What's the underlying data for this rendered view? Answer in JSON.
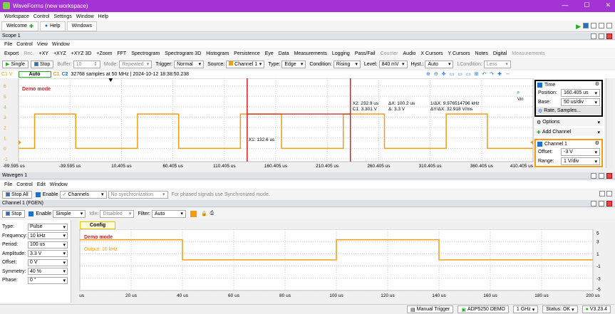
{
  "window": {
    "title": "WaveForms (new workspace)"
  },
  "menu": [
    "Workspace",
    "Control",
    "Settings",
    "Window",
    "Help"
  ],
  "tabs": [
    {
      "label": "Welcome"
    },
    {
      "label": "Help"
    },
    {
      "label": "Windows"
    }
  ],
  "scope": {
    "panel_title": "Scope 1",
    "menu": [
      "File",
      "Control",
      "View",
      "Window"
    ],
    "toolbar": [
      "Export",
      "Rec.",
      "+XY",
      "+XYZ",
      "+XYZ 3D",
      "+Zoom",
      "FFT",
      "Spectrogram",
      "Spectrogram 3D",
      "Histogram",
      "Persistence",
      "Eye",
      "Data",
      "Measurements",
      "Logging",
      "Pass/Fail",
      "Counter",
      "Audio",
      "X Cursors",
      "Y Cursors",
      "Notes",
      "Digital",
      "Measurements"
    ],
    "controls": {
      "single": "Single",
      "stop": "Stop",
      "buffer_label": "Buffer:",
      "buffer_value": "10",
      "mode_label": "Mode:",
      "mode_value": "Repeated",
      "trigger_label": "Trigger:",
      "trigger_value": "Normal",
      "source_label": "Source:",
      "source_value": "Channel 1",
      "type_label": "Type:",
      "type_value": "Edge",
      "condition_label": "Condition:",
      "condition_value": "Rising",
      "level_label": "Level:",
      "level_value": "840 mV",
      "hyst_label": "Hyst.:",
      "hyst_value": "Auto",
      "lcondition_label": "LCondition:",
      "lcondition_value": "Less"
    },
    "info": {
      "c1": "C1 V",
      "auto": "Auto",
      "c1tag": "C1",
      "c2tag": "C2",
      "samples": "32768 samples at 50 MHz | 2024-10-12 18:38:50.238",
      "demo": "Demo mode"
    },
    "y_ticks": [
      "7",
      "6",
      "5",
      "4",
      "3",
      "2",
      "1",
      "0",
      "-1"
    ],
    "x_ticks": [
      "-89.595 us",
      "-39.595 us",
      "10.405 us",
      "60.405 us",
      "110.405 us",
      "160.405 us",
      "210.405 us",
      "260.405 us",
      "310.405 us",
      "360.405 us",
      "410.405 us"
    ],
    "cursors": {
      "x1": "X1: 132.6 us",
      "x2": "X2: 232.9 us",
      "c1": "C1: 3.301 V",
      "dx": "ΔX: 100.2 us",
      "dy": "Δ: 3.3 V",
      "inv_dx": "1/ΔX: 9.976514796 kHz",
      "dy_dx": "ΔY/ΔX: 32.918 V/ms"
    },
    "side": {
      "time_title": "Time",
      "position_label": "Position:",
      "position_value": "160.405 us",
      "base_label": "Base:",
      "base_value": "50 us/div",
      "rate_label": "Rate, Samples...",
      "options": "Options",
      "add_channel": "Add Channel",
      "ch1_title": "Channel 1",
      "offset_label": "Offset:",
      "offset_value": "-3 V",
      "range_label": "Range:",
      "range_value": "1 V/div"
    },
    "vin": "Vin"
  },
  "wavegen": {
    "panel_title": "Wavegen 1",
    "menu": [
      "File",
      "Control",
      "Edit",
      "Window"
    ],
    "stop_all": "Stop All",
    "enable": "Enable",
    "channels": "Channels",
    "sync": "No synchronization",
    "hint": "For phased signals use Synchronized mode.",
    "channel_title": "Channel 1 (FGEN)",
    "stop": "Stop",
    "enable2": "Enable",
    "mode": "Simple",
    "idle_label": "Idle:",
    "idle_value": "Disabled",
    "filter_label": "Filter:",
    "filter_value": "Auto",
    "config_tab": "Config",
    "params": [
      {
        "k": "Type:",
        "v": "Pulse"
      },
      {
        "k": "Frequency:",
        "v": "10 kHz"
      },
      {
        "k": "Period:",
        "v": "100 us"
      },
      {
        "k": "Amplitude:",
        "v": "3.3 V"
      },
      {
        "k": "Offset:",
        "v": "0 V"
      },
      {
        "k": "Symmetry:",
        "v": "40 %"
      },
      {
        "k": "Phase:",
        "v": "0 °"
      }
    ],
    "plot": {
      "demo": "Demo mode",
      "output": "Output: 10 kHz",
      "x_ticks": [
        "0 us",
        "20 us",
        "40 us",
        "60 us",
        "80 us",
        "100 us",
        "120 us",
        "140 us",
        "160 us",
        "180 us",
        "200 us"
      ],
      "y_ticks": [
        "5",
        "3",
        "1",
        "-1",
        "-3",
        "-5"
      ]
    }
  },
  "status": {
    "manual_trigger": "Manual Trigger",
    "device": "ADP5250 DEMO",
    "clock": "1 GHz",
    "status": "Status: OK",
    "version": "V3.23.4"
  },
  "chart_data": [
    {
      "type": "line",
      "series": [
        {
          "name": "C1",
          "x": [
            -89.595,
            -74,
            -74,
            -34,
            -34,
            26,
            26,
            66,
            66,
            126,
            126,
            166,
            166,
            226,
            226,
            266,
            266,
            326,
            326,
            366,
            366,
            410.405
          ],
          "y": [
            0,
            0,
            3.3,
            3.3,
            0,
            0,
            3.3,
            3.3,
            0,
            0,
            3.3,
            3.3,
            0,
            0,
            3.3,
            3.3,
            0,
            0,
            3.3,
            3.3,
            0,
            0
          ]
        }
      ],
      "xlim": [
        -89.595,
        410.405
      ],
      "ylim": [
        -1,
        7
      ],
      "xlabel": "",
      "ylabel": "",
      "grid": true,
      "color": "#f39c12"
    },
    {
      "type": "line",
      "series": [
        {
          "name": "",
          "x": [
            0,
            40,
            40,
            100,
            100,
            140,
            140,
            200
          ],
          "y": [
            3.3,
            3.3,
            0,
            0,
            3.3,
            3.3,
            0,
            0
          ]
        }
      ],
      "xlim": [
        0,
        200
      ],
      "ylim": [
        -5,
        5
      ],
      "xlabel": "",
      "ylabel": "",
      "grid": true,
      "color": "#f39c12"
    }
  ],
  "colors": {
    "title": "#a433d6",
    "trace": "#f39c12",
    "cursor": "#d21e1e",
    "highlight": "#1f6fd1"
  }
}
